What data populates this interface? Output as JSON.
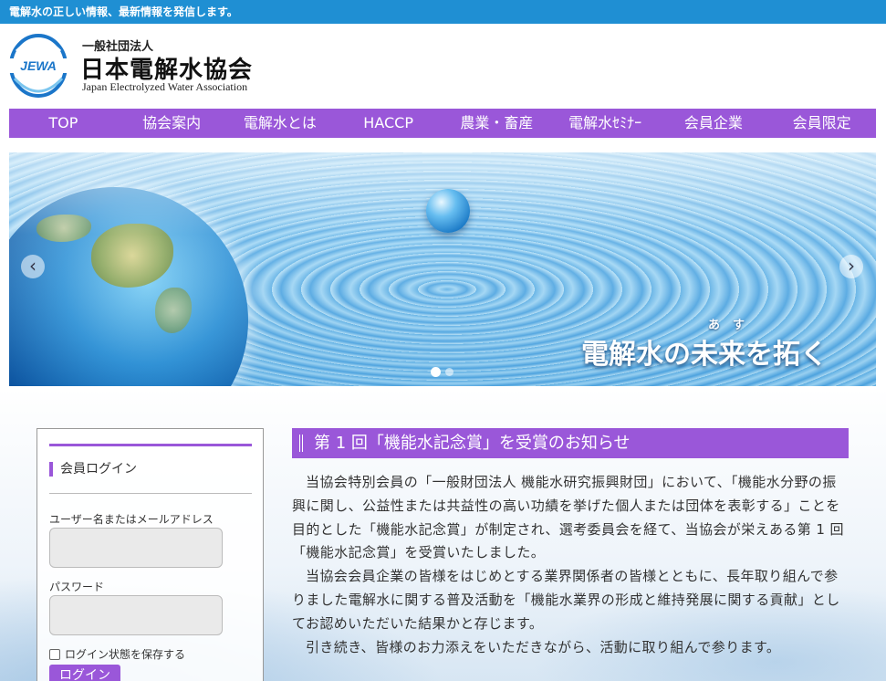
{
  "topbar": {
    "text": "電解水の正しい情報、最新情報を発信します。"
  },
  "header": {
    "logo_text": "JEWA",
    "org_small": "一般社団法人",
    "org_name": "日本電解水協会",
    "org_en": "Japan Electrolyzed Water Association"
  },
  "nav": {
    "items": [
      "TOP",
      "協会案内",
      "電解水とは",
      "HACCP",
      "農業・畜産",
      "電解水ｾﾐﾅｰ",
      "会員企業",
      "会員限定"
    ]
  },
  "slider": {
    "tagline": "電解水の未来を拓く",
    "ruby": "あす",
    "prev_icon": "chevron-left-icon",
    "next_icon": "chevron-right-icon",
    "prev_glyph": "‹",
    "next_glyph": "›",
    "slide_count": 2,
    "active_slide": 1
  },
  "sidebar": {
    "heading": "会員ログイン",
    "username_label": "ユーザー名またはメールアドレス",
    "username_value": "",
    "password_label": "パスワード",
    "password_value": "",
    "remember_label": "ログイン状態を保存する",
    "login_button": "ログイン"
  },
  "article": {
    "title": "第 1 回「機能水記念賞」を受賞のお知らせ",
    "paragraphs": [
      "当協会特別会員の「一般財団法人 機能水研究振興財団」において、「機能水分野の振興に関し、公益性または共益性の高い功績を挙げた個人または団体を表彰する」ことを目的とした「機能水記念賞」が制定され、選考委員会を経て、当協会が栄えある第 1 回「機能水記念賞」を受賞いたしました。",
      "当協会会員企業の皆様をはじめとする業界関係者の皆様とともに、長年取り組んで参りました電解水に関する普及活動を「機能水業界の形成と維持発展に関する貢献」としてお認めいただいた結果かと存じます。",
      "引き続き、皆様のお力添えをいただきながら、活動に取り組んで参ります。"
    ]
  },
  "colors": {
    "topbar": "#1f8fd3",
    "accent_purple": "#9a57d9",
    "logo_blue": "#1b76c9"
  }
}
